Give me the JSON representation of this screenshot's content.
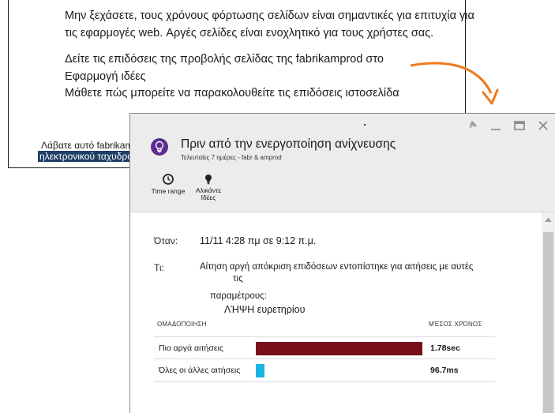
{
  "email": {
    "paragraph1_line1": "Μην ξεχάσετε, τους χρόνους φόρτωσης σελίδων είναι σημαντικές για επιτυχία για",
    "paragraph1_line2": "τις εφαρμογές web. Αργές σελίδες είναι ενοχλητικό για τους χρήστες σας.",
    "paragraph2_line1": "Δείτε τις επιδόσεις της προβολής σελίδας της fabrikamprod στο",
    "paragraph2_line2": "Εφαρμογή ιδέες",
    "paragraph2_line3": "Μάθετε πώς μπορείτε να παρακολουθείτε τις επιδόσεις ιστοσελίδα",
    "footer_line1": "Λάβατε αυτό fabrikamprod",
    "footer_line2": "ηλεκτρονικού ταχυδρομείου, για:"
  },
  "blade": {
    "title": "Πριν από την ενεργοποίηση ανίχνευσης",
    "subtitle": "Τελευταίες 7 ημέρες - fabr & amprod",
    "commands": {
      "time_range": "Time range",
      "tips_line1": "Αλικάντε",
      "tips_line2": "Ιδέες"
    },
    "when_label": "Όταν:",
    "when_value": "11/11 4:28 πμ σε 9:12 π.μ.",
    "what_label": "Τι:",
    "what_value_line1": "Αίτηση αργή απόκριση επιδόσεων εντοπίστηκε για αιτήσεις με αυτές",
    "what_value_line2": "τις",
    "params_label": "παραμέτρους:",
    "params_value": "ΛΉΨΗ ευρετηρίου",
    "group_header": "ΟΜΑΔΟΠΟΙΗΣΗ",
    "avg_header": "ΜΈΣΟΣ ΧΡΌΝΟΣ",
    "rows": [
      {
        "name": "Πιο αργά αιτήσεις",
        "value": "1.78sec",
        "fraction": 1.0,
        "color": "#7a0f1c"
      },
      {
        "name": "Όλες οι άλλες αιτήσεις",
        "value": "96.7ms",
        "fraction": 0.054,
        "color": "#1ab3e6"
      }
    ]
  },
  "colors": {
    "arrow": "#f07a1c",
    "bulb": "#5c2d91",
    "selection": "#1f3f66"
  },
  "icons": {
    "pin": "pin-icon",
    "minimize": "minimize-icon",
    "maximize": "maximize-icon",
    "close": "close-icon",
    "bulb": "lightbulb-icon",
    "clock": "clock-icon",
    "tips": "lightbulb-small-icon",
    "scroll_up": "scroll-up-arrow-icon"
  }
}
